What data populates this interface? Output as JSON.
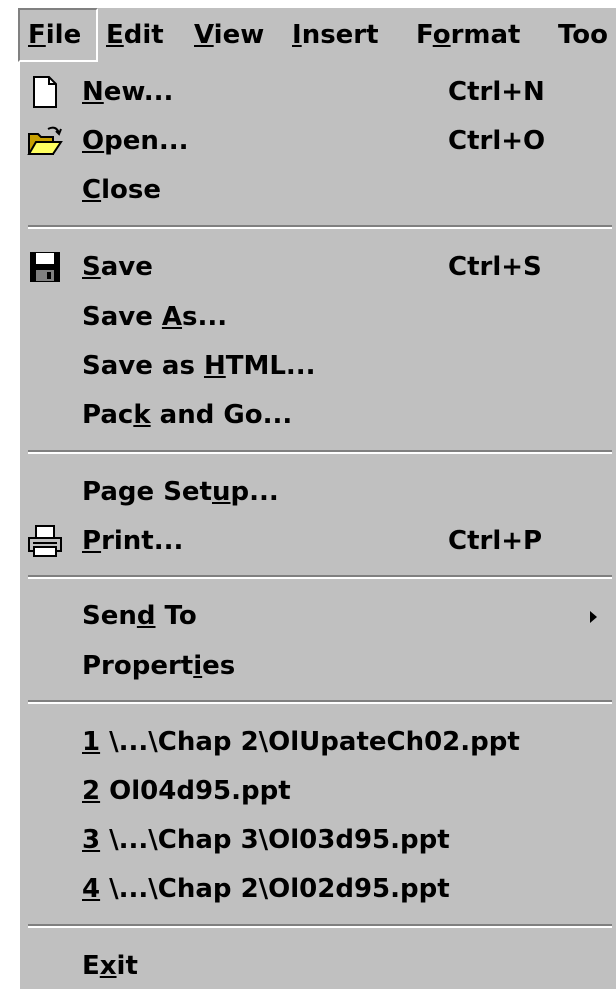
{
  "menubar": {
    "items": [
      {
        "label": "File",
        "mnemonic": "F",
        "active": true
      },
      {
        "label": "Edit",
        "mnemonic": "E"
      },
      {
        "label": "View",
        "mnemonic": "V"
      },
      {
        "label": "Insert",
        "mnemonic": "I"
      },
      {
        "label": "Format",
        "mnemonic": "o"
      },
      {
        "label": "Too",
        "mnemonic": ""
      }
    ]
  },
  "file_menu": {
    "new": {
      "label": "New...",
      "mnemonic": "N",
      "shortcut": "Ctrl+N",
      "icon": "new-document-icon"
    },
    "open": {
      "label": "Open...",
      "mnemonic": "O",
      "shortcut": "Ctrl+O",
      "icon": "open-folder-icon"
    },
    "close": {
      "label": "Close",
      "mnemonic": "C"
    },
    "save": {
      "label": "Save",
      "mnemonic": "S",
      "shortcut": "Ctrl+S",
      "icon": "floppy-disk-icon"
    },
    "save_as": {
      "label": "Save As...",
      "mnemonic": "A"
    },
    "save_html": {
      "label": "Save as HTML...",
      "mnemonic": "H"
    },
    "pack_go": {
      "label": "Pack and Go...",
      "mnemonic": "k"
    },
    "page_setup": {
      "label": "Page Setup...",
      "mnemonic": "u"
    },
    "print": {
      "label": "Print...",
      "mnemonic": "P",
      "shortcut": "Ctrl+P",
      "icon": "printer-icon"
    },
    "send_to": {
      "label": "Send To",
      "mnemonic": "d",
      "submenu": true
    },
    "properties": {
      "label": "Properties",
      "mnemonic": "i"
    },
    "recent": [
      {
        "label": "1 \\...\\Chap 2\\OlUpateCh02.ppt",
        "mnemonic": "1"
      },
      {
        "label": "2 Ol04d95.ppt",
        "mnemonic": "2"
      },
      {
        "label": "3 \\...\\Chap 3\\Ol03d95.ppt",
        "mnemonic": "3"
      },
      {
        "label": "4 \\...\\Chap 2\\Ol02d95.ppt",
        "mnemonic": "4"
      }
    ],
    "exit": {
      "label": "Exit",
      "mnemonic": "x"
    }
  }
}
